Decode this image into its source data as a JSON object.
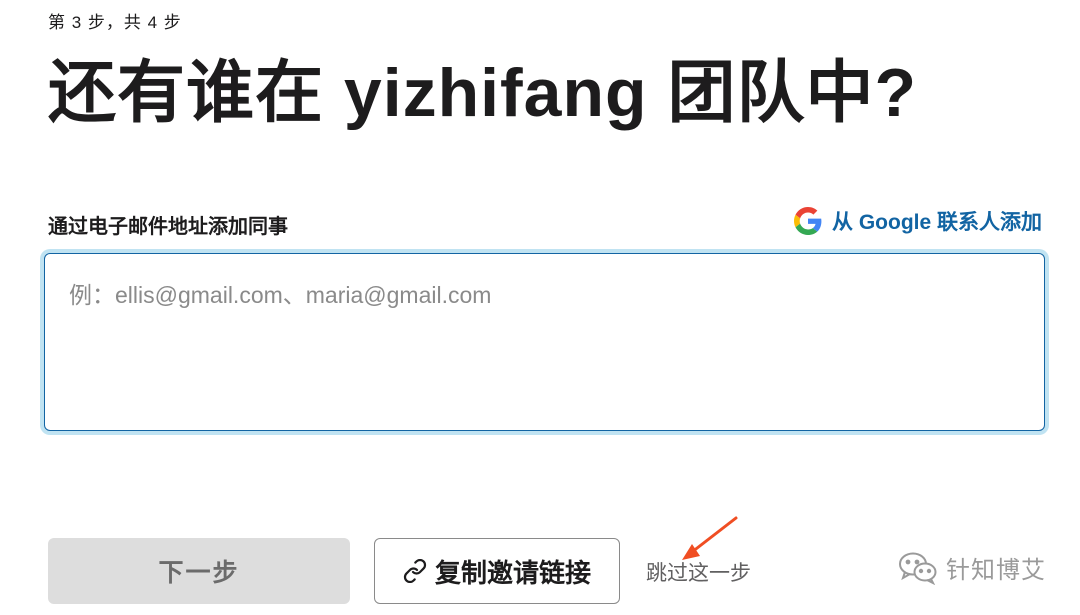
{
  "step_indicator": "第 3 步，共 4 步",
  "title": "还有谁在 yizhifang 团队中?",
  "invite": {
    "label": "通过电子邮件地址添加同事",
    "google_link": "从 Google 联系人添加",
    "google_icon": "google-icon",
    "email_placeholder": "例：ellis@gmail.com、maria@gmail.com",
    "email_value": ""
  },
  "actions": {
    "next_label": "下一步",
    "copy_link_label": "复制邀请链接",
    "copy_link_icon": "link-icon",
    "skip_label": "跳过这一步"
  },
  "watermark": {
    "text": "针知博艾",
    "icon": "wechat-icon"
  },
  "colors": {
    "accent": "#1264a3",
    "focus_ring": "#1d9bd1",
    "arrow": "#f04e23",
    "disabled_bg": "#dddddd"
  }
}
